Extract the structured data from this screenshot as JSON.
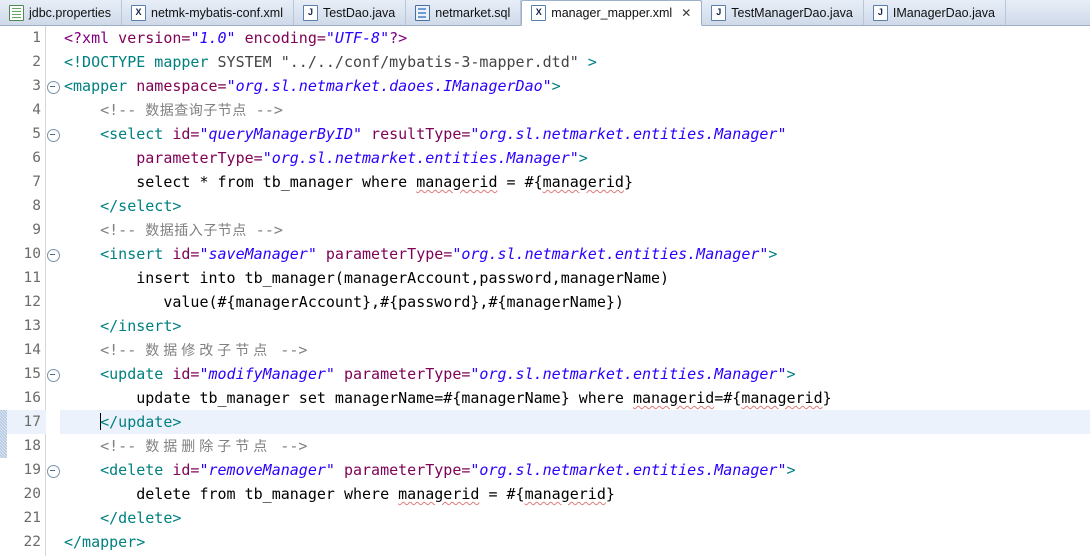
{
  "window": {
    "title": "manager_mapper.xml",
    "app": "Eclipse XML Editor"
  },
  "tabbar": {
    "tabs": [
      {
        "label": "jdbc.properties",
        "icon": "properties-file-icon",
        "active": false,
        "closable": false
      },
      {
        "label": "netmk-mybatis-conf.xml",
        "icon": "xml-file-icon",
        "active": false,
        "closable": false
      },
      {
        "label": "TestDao.java",
        "icon": "java-file-icon",
        "active": false,
        "closable": false
      },
      {
        "label": "netmarket.sql",
        "icon": "sql-file-icon",
        "active": false,
        "closable": false
      },
      {
        "label": "manager_mapper.xml",
        "icon": "xml-file-icon",
        "active": true,
        "closable": true,
        "close_glyph": "✕"
      },
      {
        "label": "TestManagerDao.java",
        "icon": "java-file-icon",
        "active": false,
        "closable": false
      },
      {
        "label": "IManagerDao.java",
        "icon": "java-file-icon",
        "active": false,
        "closable": false
      }
    ]
  },
  "editor": {
    "current_line": 17,
    "colors": {
      "tag": "#008080",
      "attribute": "#7f0055",
      "value": "#2a00ff",
      "processing_instruction": "#800080",
      "comment": "#808080",
      "text": "#000000",
      "current_line_highlight": "#ecf2fb",
      "spellcheck_underline": "#e07a7a",
      "gutter_text": "#6b6b6b",
      "background": "#ffffff"
    },
    "line_numbers": [
      "1",
      "2",
      "3",
      "4",
      "5",
      "6",
      "7",
      "8",
      "9",
      "10",
      "11",
      "12",
      "13",
      "14",
      "15",
      "16",
      "17",
      "18",
      "19",
      "20",
      "21",
      "22"
    ],
    "fold_lines": [
      3,
      5,
      10,
      15,
      19
    ],
    "change_markers": [
      17,
      18
    ],
    "lines": [
      {
        "n": 1,
        "indent": 0
      },
      {
        "n": 2,
        "indent": 0
      },
      {
        "n": 3,
        "indent": 0
      },
      {
        "n": 4,
        "indent": 0
      },
      {
        "n": 5,
        "indent": 0
      },
      {
        "n": 6,
        "indent": 0
      },
      {
        "n": 7,
        "indent": 0
      },
      {
        "n": 8,
        "indent": 0
      },
      {
        "n": 9,
        "indent": 0
      },
      {
        "n": 10,
        "indent": 0
      },
      {
        "n": 11,
        "indent": 0
      },
      {
        "n": 12,
        "indent": 0
      },
      {
        "n": 13,
        "indent": 0
      },
      {
        "n": 14,
        "indent": 0
      },
      {
        "n": 15,
        "indent": 0
      },
      {
        "n": 16,
        "indent": 0
      },
      {
        "n": 17,
        "indent": 0
      },
      {
        "n": 18,
        "indent": 0
      },
      {
        "n": 19,
        "indent": 0
      },
      {
        "n": 20,
        "indent": 0
      },
      {
        "n": 21,
        "indent": 0
      },
      {
        "n": 22,
        "indent": 0
      }
    ],
    "code": {
      "l1_pi_open": "<?xml",
      "l1_attr_version": " version=",
      "l1_val_version": "\"1.0\"",
      "l1_attr_encoding": " encoding=",
      "l1_val_encoding": "\"UTF-8\"",
      "l1_pi_close": "?>",
      "l2_doctype": "<!DOCTYPE mapper",
      "l2_system": " SYSTEM ",
      "l2_dtd": "\"../../conf/mybatis-3-mapper.dtd\"",
      "l2_gt": " >",
      "l3_tag_open": "<mapper",
      "l3_attr": " namespace=",
      "l3_val": "\"org.sl.netmarket.daoes.IManagerDao\"",
      "l3_gt": ">",
      "l4_comment": "<!-- ",
      "l4_comment_zh": "数据查询子节点",
      "l4_comment_end": " -->",
      "l5_tag_open": "<select",
      "l5_attr_id": " id=",
      "l5_val_id": "\"queryManagerByID\"",
      "l5_attr_rt": " resultType=",
      "l5_val_rt": "\"org.sl.netmarket.entities.Manager\"",
      "l6_attr_pt": "parameterType=",
      "l6_val_pt": "\"org.sl.netmarket.entities.Manager\"",
      "l6_gt": ">",
      "l7_sql_a": "select * from tb_manager where ",
      "l7_sql_b": "managerid",
      "l7_sql_c": " = #{",
      "l7_sql_d": "managerid",
      "l7_sql_e": "}",
      "l8_tag_close": "</select>",
      "l9_comment": "<!-- ",
      "l9_comment_zh": "数据插入子节点",
      "l9_comment_end": " -->",
      "l10_tag_open": "<insert",
      "l10_attr_id": " id=",
      "l10_val_id": "\"saveManager\"",
      "l10_attr_pt": " parameterType=",
      "l10_val_pt": "\"org.sl.netmarket.entities.Manager\"",
      "l10_gt": ">",
      "l11_sql": "insert into tb_manager(managerAccount,password,managerName)",
      "l12_sql": "value(#{managerAccount},#{password},#{managerName})",
      "l13_tag_close": "</insert>",
      "l14_comment": "<!-- ",
      "l14_comment_zh": "数据修改子节点",
      "l14_comment_end": " -->",
      "l15_tag_open": "<update",
      "l15_attr_id": " id=",
      "l15_val_id": "\"modifyManager\"",
      "l15_attr_pt": " parameterType=",
      "l15_val_pt": "\"org.sl.netmarket.entities.Manager\"",
      "l15_gt": ">",
      "l16_sql_a": "update tb_manager set managerName=#{managerName} where ",
      "l16_sql_b": "managerid",
      "l16_sql_c": "=#{",
      "l16_sql_d": "managerid",
      "l16_sql_e": "}",
      "l17_tag_close": "</update>",
      "l18_comment": "<!-- ",
      "l18_comment_zh": "数据删除子节点",
      "l18_comment_end": " -->",
      "l19_tag_open": "<delete",
      "l19_attr_id": " id=",
      "l19_val_id": "\"removeManager\"",
      "l19_attr_pt": " parameterType=",
      "l19_val_pt": "\"org.sl.netmarket.entities.Manager\"",
      "l19_gt": ">",
      "l20_sql_a": "delete from tb_manager where ",
      "l20_sql_b": "managerid",
      "l20_sql_c": " = #{",
      "l20_sql_d": "managerid",
      "l20_sql_e": "}",
      "l21_tag_close": "</delete>",
      "l22_tag_close": "</mapper>"
    }
  }
}
